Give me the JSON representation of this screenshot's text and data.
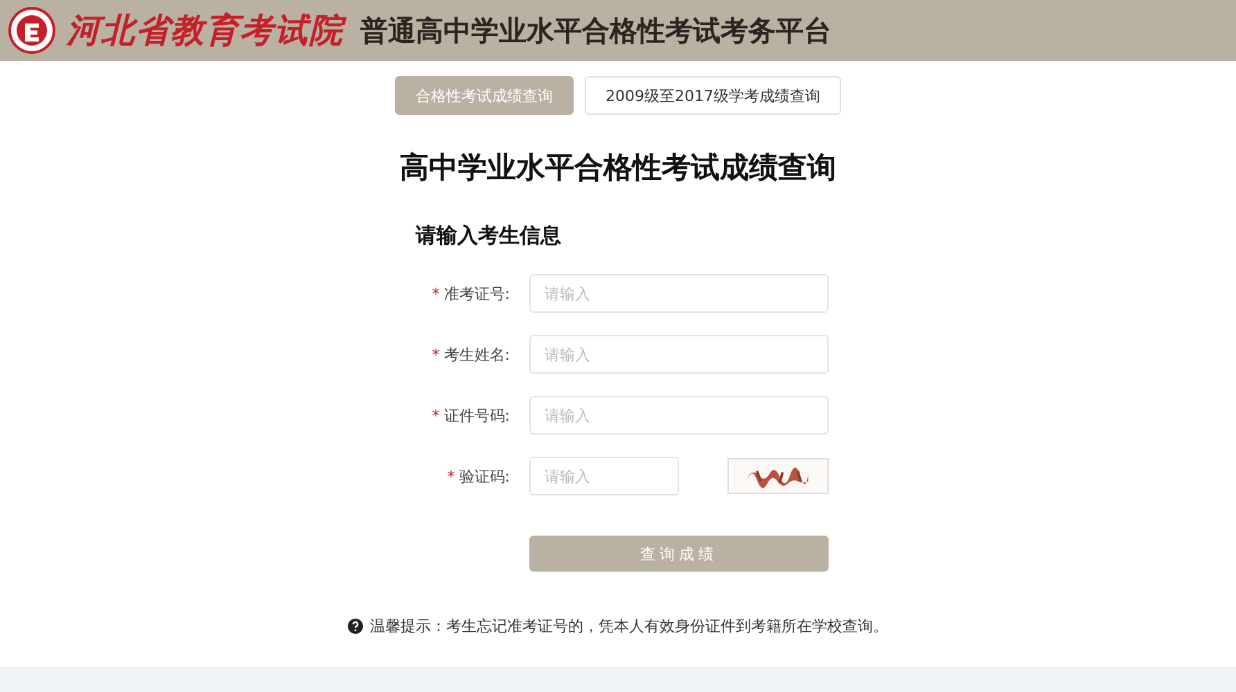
{
  "header": {
    "logo_text": "河北省教育考试院",
    "platform_title": "普通高中学业水平合格性考试考务平台"
  },
  "tabs": [
    {
      "label": "合格性考试成绩查询",
      "selected": true
    },
    {
      "label": "2009级至2017级学考成绩查询",
      "selected": false
    }
  ],
  "page_title": "高中学业水平合格性考试成绩查询",
  "section_title": "请输入考生信息",
  "fields": [
    {
      "kind": "text",
      "required_mark": "*",
      "label": "准考证号:",
      "placeholder": "请输入"
    },
    {
      "kind": "text",
      "required_mark": "*",
      "label": "考生姓名:",
      "placeholder": "请输入"
    },
    {
      "kind": "text",
      "required_mark": "*",
      "label": "证件号码:",
      "placeholder": "请输入"
    },
    {
      "kind": "captcha",
      "required_mark": "*",
      "label": "验证码:",
      "placeholder": "请输入"
    }
  ],
  "submit_button": "查询成绩",
  "tip": "温馨提示：考生忘记准考证号的，凭本人有效身份证件到考籍所在学校查询。"
}
